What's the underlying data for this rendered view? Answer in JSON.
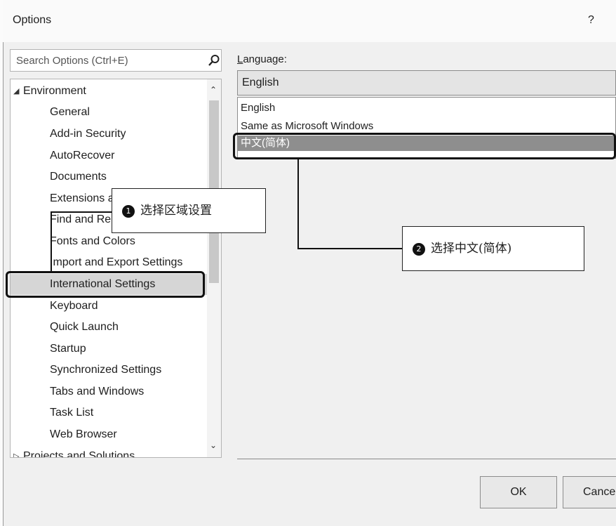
{
  "window": {
    "title": "Options",
    "help": "?"
  },
  "search": {
    "placeholder": "Search Options (Ctrl+E)"
  },
  "tree": {
    "environment": "Environment",
    "items": [
      "General",
      "Add-in Security",
      "AutoRecover",
      "Documents",
      "Extensions and Updates",
      "Find and Replace",
      "Fonts and Colors",
      "Import and Export Settings",
      "International Settings",
      "Keyboard",
      "Quick Launch",
      "Startup",
      "Synchronized Settings",
      "Tabs and Windows",
      "Task List",
      "Web Browser"
    ],
    "projects": "Projects and Solutions",
    "selected": "International Settings"
  },
  "language": {
    "label_accel": "L",
    "label_rest": "anguage:",
    "selected": "English",
    "options": [
      "English",
      "Same as Microsoft Windows",
      "中文(简体)"
    ],
    "highlighted": "中文(简体)"
  },
  "buttons": {
    "ok": "OK",
    "cancel": "Cancel"
  },
  "annotations": {
    "step1": {
      "number": "1",
      "text": "选择区域设置"
    },
    "step2": {
      "number": "2",
      "text": "选择中文(简体)"
    }
  },
  "colors": {
    "selection": "#d6d6d6",
    "dropdown_highlight": "#8e8e8e"
  }
}
